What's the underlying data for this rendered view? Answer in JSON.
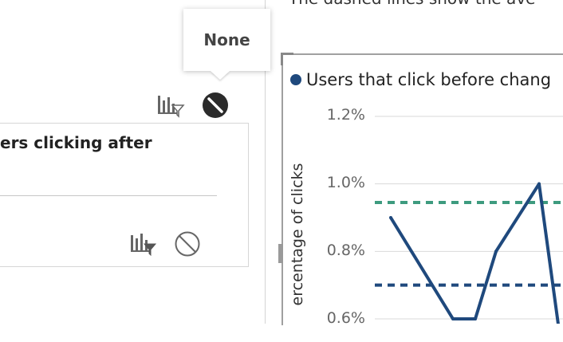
{
  "caption": {
    "text": "The dashed lines show the ave"
  },
  "tooltip": {
    "text": "None"
  },
  "card": {
    "title": "ers clicking after"
  },
  "icons": {
    "filter_icon": "bar-chart-filter-icon",
    "no_filter_icon": "no-filter-icon"
  },
  "chart_data": {
    "type": "line",
    "series": [
      {
        "name": "Users that click before chang",
        "values": [
          0.9,
          0.6,
          0.6,
          0.8,
          1.0,
          0.55
        ]
      }
    ],
    "reference_lines": [
      {
        "value": 0.945,
        "color": "#3e9b7f",
        "style": "dashed"
      },
      {
        "value": 0.7,
        "color": "#1f497d",
        "style": "dashed"
      }
    ],
    "ylabel": "ercentage of clicks",
    "yticks": [
      "1.2%",
      "1.0%",
      "0.8%",
      "0.6%"
    ],
    "ytick_values": [
      1.2,
      1.0,
      0.8,
      0.6
    ],
    "ylim": [
      0.6,
      1.2
    ],
    "grid": true,
    "legend": "top-left",
    "colors": {
      "line": "#1f497d",
      "grid": "#d9d9d9"
    }
  }
}
